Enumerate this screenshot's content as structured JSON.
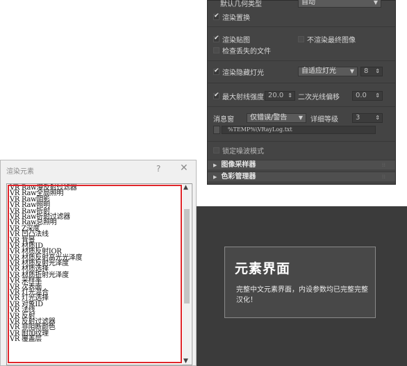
{
  "vray": {
    "row_top_label": "默认几何类型",
    "row_top_value": "自动",
    "override_mtl": "渲染置换",
    "render_maps": "渲染贴图",
    "no_final_image": "不渲染最终图像",
    "check_missing": "检查丢失的文件",
    "hidden_lights": "渲染隐藏灯光",
    "hidden_lights_value": "自适应灯光",
    "hidden_lights_num": "8",
    "max_ray_intensity": "最大射线强度",
    "max_ray_value": "20.0",
    "secondary_bias": "二次光线偏移",
    "secondary_bias_value": "0.0",
    "log_window": "消息窗",
    "log_window_value": "仅错误/警告",
    "verbose_level": "详细等级",
    "verbose_value": "3",
    "log_path": "%TEMP%\\VRayLog.txt",
    "lock_noise": "锁定噪波模式",
    "rollout_image_sampler": "图像采样器",
    "rollout_color_mapping": "色彩管理器"
  },
  "dialog": {
    "title": "渲染元素",
    "help": "?",
    "close": "✕",
    "items": [
      "VR Raw漫反射过滤器",
      "VR Raw全局照明",
      "VR Raw阴影",
      "VR Raw照明",
      "VR Raw折射",
      "VR Raw折射过滤器",
      "VR Raw总照明",
      "VR Z深度",
      "VR 凹凸法线",
      "VR 背景",
      "VR 材质ID",
      "VR 材质反射IOR",
      "VR 材质反射高光光泽度",
      "VR 材质反射光泽度",
      "VR 材质选择",
      "VR 材质折射光泽度",
      "VR 采样率",
      "VR 次表面",
      "VR 灯光混合",
      "VR 灯光选择",
      "VR 对象ID",
      "VR 法线",
      "VR 反射",
      "VR 反射过滤器",
      "VR 非阻断颜色",
      "VR 附加纹理",
      "VR 覆盖层"
    ]
  },
  "feature": {
    "title": "元素界面",
    "desc": "完整中文元素界面，内设参数均已完整完整汉化！"
  },
  "colors": {
    "accent_red": "#e0262b",
    "panel_bg": "#444444",
    "band_bg": "#3b3b3b"
  }
}
